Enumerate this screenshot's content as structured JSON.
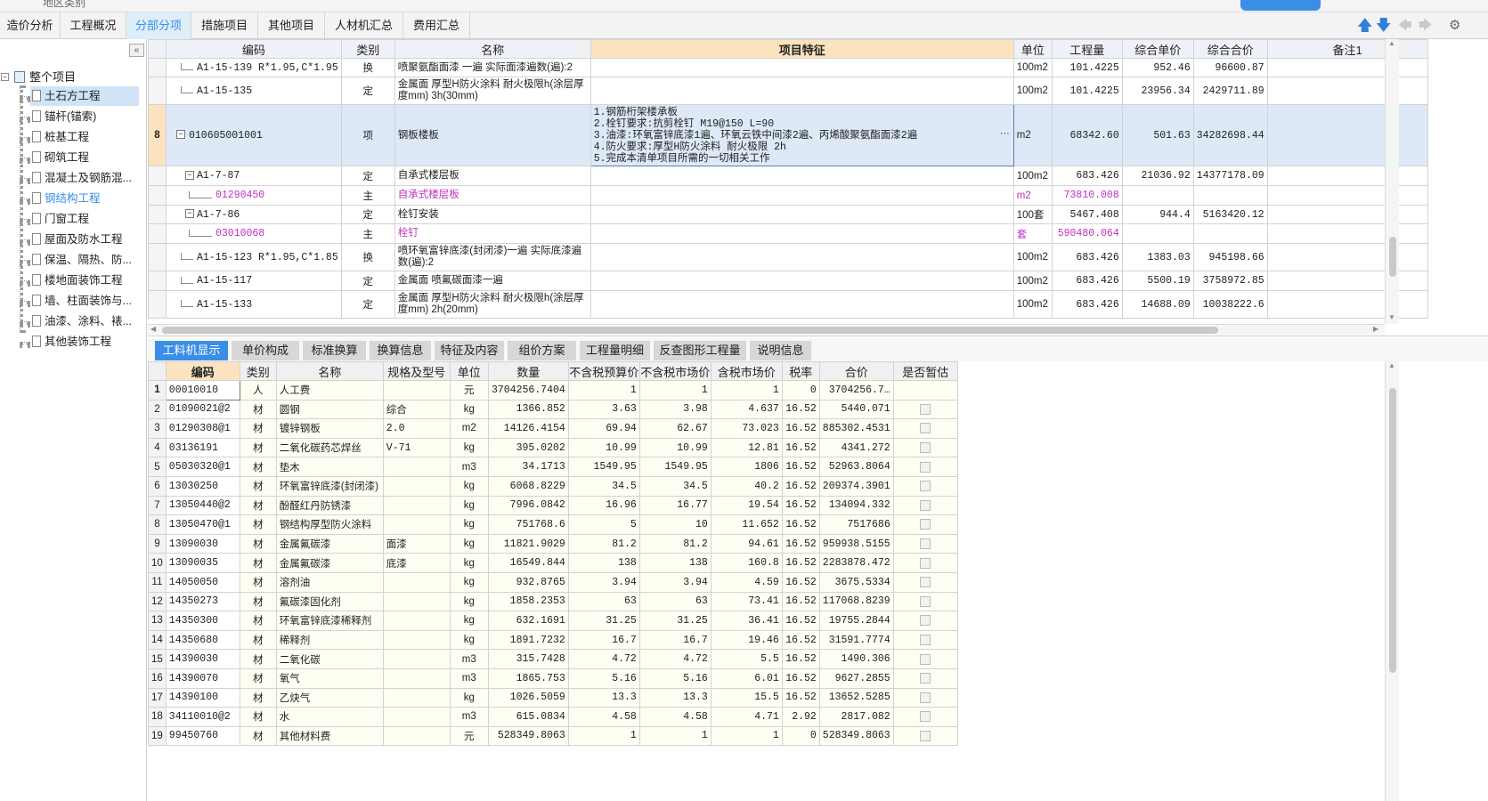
{
  "top_strip": {
    "region_label": "地区类别"
  },
  "main_tabs": [
    {
      "label": "造价分析"
    },
    {
      "label": "工程概况"
    },
    {
      "label": "分部分项"
    },
    {
      "label": "措施项目"
    },
    {
      "label": "其他项目"
    },
    {
      "label": "人材机汇总"
    },
    {
      "label": "费用汇总"
    }
  ],
  "active_main_tab": "分部分项",
  "toolbar_icons": [
    "arrow-up-icon",
    "arrow-down-icon",
    "arrow-left-icon",
    "arrow-right-icon",
    "settings-icon"
  ],
  "sidebar": {
    "collapse_label": "«",
    "root": "整个项目",
    "items": [
      {
        "label": "土石方工程",
        "state": "selected"
      },
      {
        "label": "锚杆(锚索)"
      },
      {
        "label": "桩基工程"
      },
      {
        "label": "砌筑工程"
      },
      {
        "label": "混凝土及钢筋混..."
      },
      {
        "label": "钢结构工程",
        "state": "current"
      },
      {
        "label": "门窗工程"
      },
      {
        "label": "屋面及防水工程"
      },
      {
        "label": "保温、隔热、防..."
      },
      {
        "label": "楼地面装饰工程"
      },
      {
        "label": "墙、柱面装饰与..."
      },
      {
        "label": "油漆、涂料、裱..."
      },
      {
        "label": "其他装饰工程"
      }
    ]
  },
  "upper_table": {
    "headers": [
      "编码",
      "类别",
      "名称",
      "项目特征",
      "单位",
      "工程量",
      "综合单价",
      "综合合价",
      "备注1"
    ],
    "rows": [
      {
        "rn": "",
        "code": "A1-15-139 R*1.95,C*1.95",
        "type": "换",
        "name": "喷聚氨酯面漆 一遍  实际面漆遍数(遍):2",
        "feature": "",
        "unit": "100m2",
        "qty": "101.4225",
        "uprice": "952.46",
        "total": "96600.87",
        "note": ""
      },
      {
        "rn": "",
        "code": "A1-15-135",
        "type": "定",
        "name": "金属面 厚型H防火涂料 耐火极限h(涂层厚度mm) 3h(30mm)",
        "feature": "",
        "unit": "100m2",
        "qty": "101.4225",
        "uprice": "23956.34",
        "total": "2429711.89",
        "note": ""
      },
      {
        "rn": "8",
        "code": "010605001001",
        "type": "项",
        "name": "钢板楼板",
        "feature": "1.钢筋桁架楼承板\n2.栓钉要求:抗剪栓钉 M19@150 L=90\n3.油漆:环氧富锌底漆1遍、环氧云铁中间漆2遍、丙烯酸聚氨酯面漆2遍\n4.防火要求:厚型H防火涂料 耐火极限 2h\n5.完成本清单项目所需的一切相关工作",
        "unit": "m2",
        "qty": "68342.60",
        "uprice": "501.63",
        "total": "34282698.44",
        "note": ""
      },
      {
        "rn": "",
        "code": "A1-7-87",
        "type": "定",
        "name": "自承式楼层板",
        "feature": "",
        "unit": "100m2",
        "qty": "683.426",
        "uprice": "21036.92",
        "total": "14377178.09",
        "note": ""
      },
      {
        "rn": "",
        "code": "01290450",
        "type": "主",
        "name": "自承式楼层板",
        "feature": "",
        "unit": "m2",
        "qty": "73810.008",
        "uprice": "",
        "total": "",
        "note": ""
      },
      {
        "rn": "",
        "code": "A1-7-86",
        "type": "定",
        "name": "栓钉安装",
        "feature": "",
        "unit": "100套",
        "qty": "5467.408",
        "uprice": "944.4",
        "total": "5163420.12",
        "note": ""
      },
      {
        "rn": "",
        "code": "03010068",
        "type": "主",
        "name": "栓钉",
        "feature": "",
        "unit": "套",
        "qty": "590480.064",
        "uprice": "",
        "total": "",
        "note": ""
      },
      {
        "rn": "",
        "code": "A1-15-123 R*1.95,C*1.85",
        "type": "换",
        "name": "喷环氧富锌底漆(封闭漆)一遍  实际底漆遍数(遍):2",
        "feature": "",
        "unit": "100m2",
        "qty": "683.426",
        "uprice": "1383.03",
        "total": "945198.66",
        "note": ""
      },
      {
        "rn": "",
        "code": "A1-15-117",
        "type": "定",
        "name": "金属面 喷氟碳面漆一遍",
        "feature": "",
        "unit": "100m2",
        "qty": "683.426",
        "uprice": "5500.19",
        "total": "3758972.85",
        "note": ""
      },
      {
        "rn": "",
        "code": "A1-15-133",
        "type": "定",
        "name": "金属面 厚型H防火涂料 耐火极限h(涂层厚度mm) 2h(20mm)",
        "feature": "",
        "unit": "100m2",
        "qty": "683.426",
        "uprice": "14688.09",
        "total": "10038222.6",
        "note": ""
      }
    ]
  },
  "sub_tabs": [
    {
      "label": "工料机显示"
    },
    {
      "label": "单价构成"
    },
    {
      "label": "标准换算"
    },
    {
      "label": "换算信息"
    },
    {
      "label": "特征及内容"
    },
    {
      "label": "组价方案"
    },
    {
      "label": "工程量明细"
    },
    {
      "label": "反查图形工程量"
    },
    {
      "label": "说明信息"
    }
  ],
  "active_sub_tab": "工料机显示",
  "lower_table": {
    "headers": [
      "编码",
      "类别",
      "名称",
      "规格及型号",
      "单位",
      "数量",
      "不含税预算价",
      "不含税市场价",
      "含税市场价",
      "税率",
      "合价",
      "是否暂估"
    ],
    "rows": [
      {
        "rn": "1",
        "code": "00010010",
        "type": "人",
        "name": "人工费",
        "spec": "",
        "unit": "元",
        "qty": "3704256.7404",
        "p1": "1",
        "p2": "1",
        "p3": "1",
        "tax": "0",
        "amt": "3704256.7…"
      },
      {
        "rn": "2",
        "code": "01090021@2",
        "type": "材",
        "name": "圆钢",
        "spec": "综合",
        "unit": "kg",
        "qty": "1366.852",
        "p1": "3.63",
        "p2": "3.98",
        "p3": "4.637",
        "tax": "16.52",
        "amt": "5440.071"
      },
      {
        "rn": "3",
        "code": "01290308@1",
        "type": "材",
        "name": "镀锌钢板",
        "spec": "2.0",
        "unit": "m2",
        "qty": "14126.4154",
        "p1": "69.94",
        "p2": "62.67",
        "p3": "73.023",
        "tax": "16.52",
        "amt": "885302.4531"
      },
      {
        "rn": "4",
        "code": "03136191",
        "type": "材",
        "name": "二氧化碳药芯焊丝",
        "spec": "V-71",
        "unit": "kg",
        "qty": "395.0202",
        "p1": "10.99",
        "p2": "10.99",
        "p3": "12.81",
        "tax": "16.52",
        "amt": "4341.272"
      },
      {
        "rn": "5",
        "code": "05030320@1",
        "type": "材",
        "name": "垫木",
        "spec": "",
        "unit": "m3",
        "qty": "34.1713",
        "p1": "1549.95",
        "p2": "1549.95",
        "p3": "1806",
        "tax": "16.52",
        "amt": "52963.8064"
      },
      {
        "rn": "6",
        "code": "13030250",
        "type": "材",
        "name": "环氧富锌底漆(封闭漆)",
        "spec": "",
        "unit": "kg",
        "qty": "6068.8229",
        "p1": "34.5",
        "p2": "34.5",
        "p3": "40.2",
        "tax": "16.52",
        "amt": "209374.3901"
      },
      {
        "rn": "7",
        "code": "13050440@2",
        "type": "材",
        "name": "酚醛红丹防锈漆",
        "spec": "",
        "unit": "kg",
        "qty": "7996.0842",
        "p1": "16.96",
        "p2": "16.77",
        "p3": "19.54",
        "tax": "16.52",
        "amt": "134094.332"
      },
      {
        "rn": "8",
        "code": "13050470@1",
        "type": "材",
        "name": "钢结构厚型防火涂料",
        "spec": "",
        "unit": "kg",
        "qty": "751768.6",
        "p1": "5",
        "p2": "10",
        "p3": "11.652",
        "tax": "16.52",
        "amt": "7517686"
      },
      {
        "rn": "9",
        "code": "13090030",
        "type": "材",
        "name": "金属氟碳漆",
        "spec": "面漆",
        "unit": "kg",
        "qty": "11821.9029",
        "p1": "81.2",
        "p2": "81.2",
        "p3": "94.61",
        "tax": "16.52",
        "amt": "959938.5155"
      },
      {
        "rn": "10",
        "code": "13090035",
        "type": "材",
        "name": "金属氟碳漆",
        "spec": "底漆",
        "unit": "kg",
        "qty": "16549.844",
        "p1": "138",
        "p2": "138",
        "p3": "160.8",
        "tax": "16.52",
        "amt": "2283878.472"
      },
      {
        "rn": "11",
        "code": "14050050",
        "type": "材",
        "name": "溶剂油",
        "spec": "",
        "unit": "kg",
        "qty": "932.8765",
        "p1": "3.94",
        "p2": "3.94",
        "p3": "4.59",
        "tax": "16.52",
        "amt": "3675.5334"
      },
      {
        "rn": "12",
        "code": "14350273",
        "type": "材",
        "name": "氟碳漆固化剂",
        "spec": "",
        "unit": "kg",
        "qty": "1858.2353",
        "p1": "63",
        "p2": "63",
        "p3": "73.41",
        "tax": "16.52",
        "amt": "117068.8239"
      },
      {
        "rn": "13",
        "code": "14350300",
        "type": "材",
        "name": "环氧富锌底漆稀释剂",
        "spec": "",
        "unit": "kg",
        "qty": "632.1691",
        "p1": "31.25",
        "p2": "31.25",
        "p3": "36.41",
        "tax": "16.52",
        "amt": "19755.2844"
      },
      {
        "rn": "14",
        "code": "14350680",
        "type": "材",
        "name": "稀释剂",
        "spec": "",
        "unit": "kg",
        "qty": "1891.7232",
        "p1": "16.7",
        "p2": "16.7",
        "p3": "19.46",
        "tax": "16.52",
        "amt": "31591.7774"
      },
      {
        "rn": "15",
        "code": "14390030",
        "type": "材",
        "name": "二氧化碳",
        "spec": "",
        "unit": "m3",
        "qty": "315.7428",
        "p1": "4.72",
        "p2": "4.72",
        "p3": "5.5",
        "tax": "16.52",
        "amt": "1490.306"
      },
      {
        "rn": "16",
        "code": "14390070",
        "type": "材",
        "name": "氧气",
        "spec": "",
        "unit": "m3",
        "qty": "1865.753",
        "p1": "5.16",
        "p2": "5.16",
        "p3": "6.01",
        "tax": "16.52",
        "amt": "9627.2855"
      },
      {
        "rn": "17",
        "code": "14390100",
        "type": "材",
        "name": "乙炔气",
        "spec": "",
        "unit": "kg",
        "qty": "1026.5059",
        "p1": "13.3",
        "p2": "13.3",
        "p3": "15.5",
        "tax": "16.52",
        "amt": "13652.5285"
      },
      {
        "rn": "18",
        "code": "34110010@2",
        "type": "材",
        "name": "水",
        "spec": "",
        "unit": "m3",
        "qty": "615.0834",
        "p1": "4.58",
        "p2": "4.58",
        "p3": "4.71",
        "tax": "2.92",
        "amt": "2817.082"
      },
      {
        "rn": "19",
        "code": "99450760",
        "type": "材",
        "name": "其他材料费",
        "spec": "",
        "unit": "元",
        "qty": "528349.8063",
        "p1": "1",
        "p2": "1",
        "p3": "1",
        "tax": "0",
        "amt": "528349.8063"
      }
    ]
  }
}
